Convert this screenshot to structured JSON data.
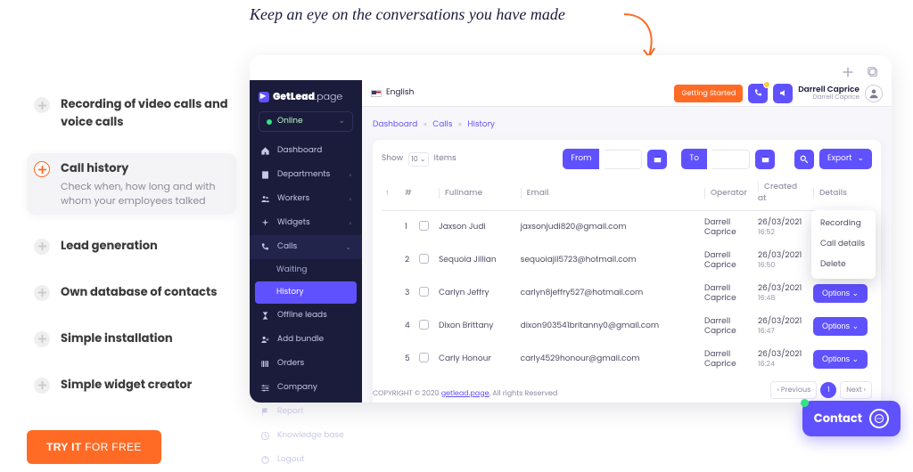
{
  "callout": "Keep an eye on the conversations you have made",
  "features": [
    {
      "title": "Recording of video calls and voice calls"
    },
    {
      "title": "Call history",
      "desc": "Check when, how long and with whom your employees talked",
      "active": true
    },
    {
      "title": "Lead generation"
    },
    {
      "title": "Own database of contacts"
    },
    {
      "title": "Simple installation"
    },
    {
      "title": "Simple widget creator"
    }
  ],
  "cta": {
    "bold": "TRY IT",
    "rest": " FOR FREE"
  },
  "brand": {
    "dot": "●«",
    "strong": "GetLead",
    "thin": ".page"
  },
  "status": {
    "label": "Online",
    "chev": "⌄"
  },
  "nav": [
    {
      "label": "Dashboard",
      "icon": "home"
    },
    {
      "label": "Departments",
      "icon": "building",
      "chev": true
    },
    {
      "label": "Workers",
      "icon": "users",
      "chev": true
    },
    {
      "label": "Widgets",
      "icon": "spark",
      "chev": true
    },
    {
      "label": "Calls",
      "icon": "phone",
      "chev": true,
      "expanded": true
    },
    {
      "label": "Offline leads",
      "icon": "hourglass"
    },
    {
      "label": "Add bundle",
      "icon": "userplus"
    },
    {
      "label": "Orders",
      "icon": "barcode"
    },
    {
      "label": "Company",
      "icon": "sliders"
    },
    {
      "label": "Report",
      "icon": "flag"
    },
    {
      "label": "Knowledge base",
      "icon": "clock"
    },
    {
      "label": "Logout",
      "icon": "power"
    }
  ],
  "calls_sub": [
    {
      "label": "Waiting"
    },
    {
      "label": "History",
      "active": true
    }
  ],
  "topbar": {
    "language": "English",
    "getting_started": "Getting Started",
    "user_name": "Darrell Caprice",
    "user_sub": "Darrell Caprice"
  },
  "crumbs": {
    "a": "Dashboard",
    "b": "Calls",
    "c": "History",
    "sep": "»"
  },
  "toolbar": {
    "show": "Show",
    "count": "10",
    "items": "items",
    "from": "From",
    "to": "To",
    "export": "Export"
  },
  "columns": {
    "num": "#",
    "fullname": "Fullname",
    "email": "Email",
    "operator": "Operator",
    "created": "Created at",
    "details": "Details",
    "options": "Options"
  },
  "rows": [
    {
      "n": "1",
      "name": "Jaxson Judi",
      "email": "jaxsonjudi820@gmail.com",
      "op": "Darrell Caprice",
      "date": "26/03/2021",
      "time": "16:52"
    },
    {
      "n": "2",
      "name": "Sequoia Jillian",
      "email": "sequoiajil5723@hotmail.com",
      "op": "Darrell Caprice",
      "date": "26/03/2021",
      "time": "16:50"
    },
    {
      "n": "3",
      "name": "Carlyn Jeffry",
      "email": "carlyn8jeffry527@hotmail.com",
      "op": "Darrell Caprice",
      "date": "26/03/2021",
      "time": "16:48"
    },
    {
      "n": "4",
      "name": "Dixon Brittany",
      "email": "dixon903541britanny0@gmail.com",
      "op": "Darrell Caprice",
      "date": "26/03/2021",
      "time": "16:47"
    },
    {
      "n": "5",
      "name": "Carly Honour",
      "email": "carly4529honour@gmail.com",
      "op": "Darrell Caprice",
      "date": "26/03/2021",
      "time": "16:24"
    }
  ],
  "options_menu": {
    "a": "Recording",
    "b": "Call details",
    "c": "Delete"
  },
  "pager": {
    "prev": "‹ Previous",
    "cur": "1",
    "next": "Next ›"
  },
  "copyright": {
    "pre": "COPYRIGHT © 2020 ",
    "link": "getlead.page",
    "post": ", All rights Reserved"
  },
  "contact": "Contact"
}
